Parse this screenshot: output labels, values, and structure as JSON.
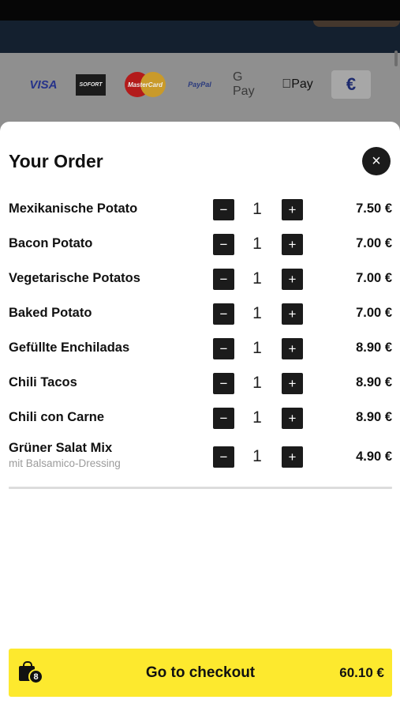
{
  "payment_methods": [
    {
      "name": "Visa",
      "label": "VISA"
    },
    {
      "name": "Sofort",
      "label": "SOFORT"
    },
    {
      "name": "MasterCard",
      "label": "MasterCard"
    },
    {
      "name": "PayPal",
      "label": "PayPal"
    },
    {
      "name": "Google Pay",
      "label": "G Pay"
    },
    {
      "name": "Apple Pay",
      "label": "Pay"
    },
    {
      "name": "Euro",
      "label": "€"
    }
  ],
  "order": {
    "title": "Your Order",
    "close_icon": "×",
    "minus_glyph": "−",
    "plus_glyph": "+",
    "items": [
      {
        "name": "Mexikanische Potato",
        "subtitle": "",
        "quantity": "1",
        "price": "7.50 €"
      },
      {
        "name": "Bacon Potato",
        "subtitle": "",
        "quantity": "1",
        "price": "7.00 €"
      },
      {
        "name": "Vegetarische Potatos",
        "subtitle": "",
        "quantity": "1",
        "price": "7.00 €"
      },
      {
        "name": "Baked Potato",
        "subtitle": "",
        "quantity": "1",
        "price": "7.00 €"
      },
      {
        "name": "Gefüllte Enchiladas",
        "subtitle": "",
        "quantity": "1",
        "price": "8.90 €"
      },
      {
        "name": "Chili Tacos",
        "subtitle": "",
        "quantity": "1",
        "price": "8.90 €"
      },
      {
        "name": "Chili con Carne",
        "subtitle": "",
        "quantity": "1",
        "price": "8.90 €"
      },
      {
        "name": "Grüner Salat Mix",
        "subtitle": "mit Balsamico-Dressing",
        "quantity": "1",
        "price": "4.90 €"
      }
    ]
  },
  "checkout": {
    "label": "Go to checkout",
    "total": "60.10 €",
    "cart_count": "8",
    "icon": "shopping-bag-icon"
  },
  "colors": {
    "accent": "#fde92e",
    "button_dark": "#1b1b1b"
  }
}
